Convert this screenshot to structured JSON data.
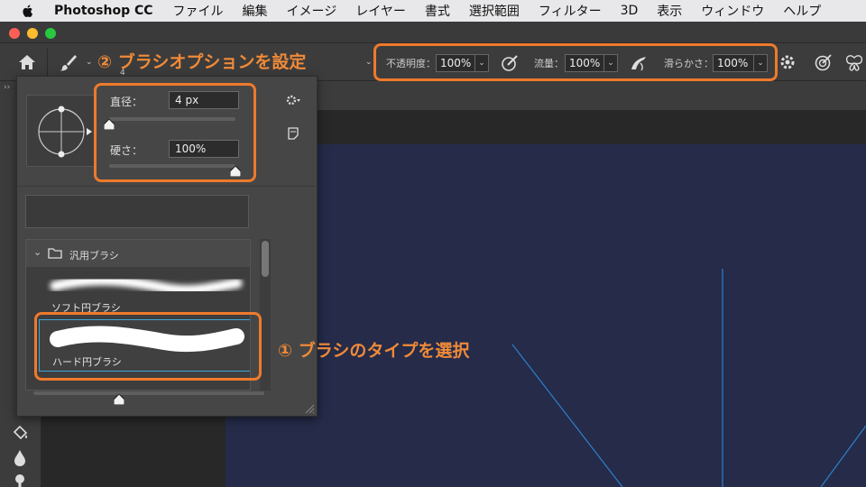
{
  "menubar": {
    "app_name": "Photoshop CC",
    "items": [
      "ファイル",
      "編集",
      "イメージ",
      "レイヤー",
      "書式",
      "選択範囲",
      "フィルター",
      "3D",
      "表示",
      "ウィンドウ",
      "ヘルプ"
    ]
  },
  "options_bar": {
    "brush_size_value": "4",
    "opacity_label": "不透明度：",
    "opacity_value": "100%",
    "flow_label": "流量：",
    "flow_value": "100%",
    "smoothing_label": "滑らかさ：",
    "smoothing_value": "100%"
  },
  "brush_panel": {
    "size_label": "直径：",
    "size_value": "4 px",
    "size_fraction": 0,
    "hardness_label": "硬さ：",
    "hardness_value": "100%",
    "hardness_fraction": 1,
    "folder_name": "汎用ブラシ",
    "brushes": [
      {
        "name": "ソフト円ブラシ",
        "selected": false
      },
      {
        "name": "ハード円ブラシ",
        "selected": true
      }
    ]
  },
  "annotations": {
    "step1": "① ブラシのタイプを選択",
    "step2": "② ブラシオプションを設定"
  },
  "colors": {
    "accent_orange": "#ee7a2c",
    "artboard": "#252b49",
    "guide_line": "#2f7fd0",
    "selection_outline": "#3fa5d8"
  },
  "icons": [
    "apple-icon",
    "home-icon",
    "brush-icon",
    "brush-settings-icon",
    "airbrush-icon",
    "angle-icon",
    "gear-icon",
    "pressure-icon",
    "symmetry-icon",
    "folder-icon",
    "new-preset-icon",
    "panel-gear-icon"
  ]
}
